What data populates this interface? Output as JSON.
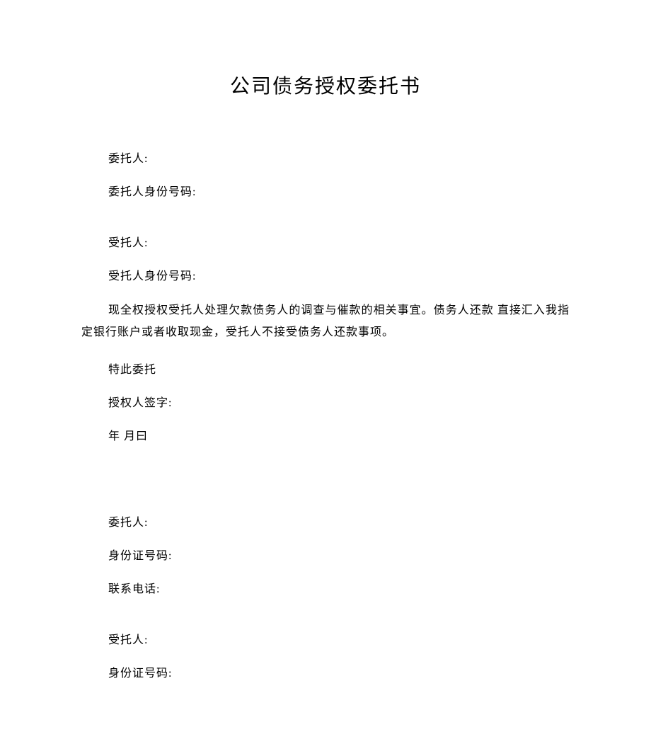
{
  "title": "公司债务授权委托书",
  "section1": {
    "client_label": "委托人:",
    "client_id_label": "委托人身份号码:",
    "trustee_label": "受托人:",
    "trustee_id_label": "受托人身份号码:"
  },
  "body_paragraph": "现全权授权受托人处理欠款债务人的调查与催款的相关事宜。债务人还款 直接汇入我指定银行账户或者收取现金，受托人不接受债务人还款事项。",
  "closing": "特此委托",
  "signature_label": "授权人签字:",
  "date_label": "年 月曰",
  "section2": {
    "client_label": "委托人:",
    "id_label": "身份证号码:",
    "phone_label": "联系电话:",
    "trustee_label": "受托人:",
    "trustee_id_label": "身份证号码:"
  }
}
